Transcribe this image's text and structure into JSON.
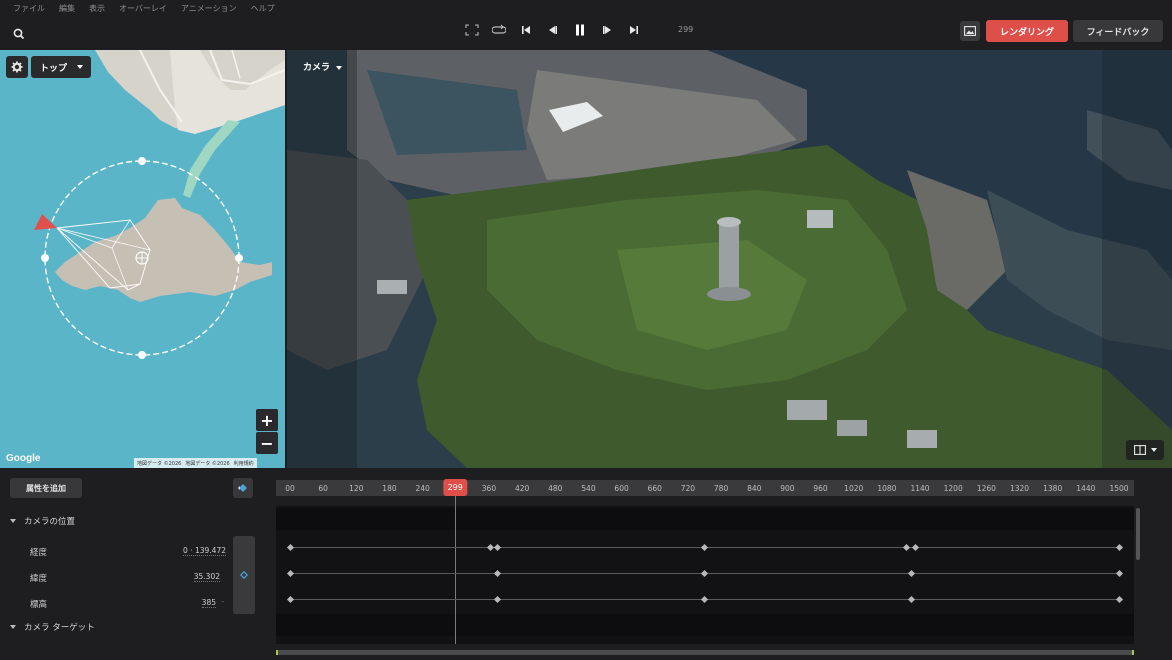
{
  "menu": [
    "ファイル",
    "編集",
    "表示",
    "オーバーレイ",
    "アニメーション",
    "ヘルプ"
  ],
  "toolbar": {
    "search_icon": "search-icon",
    "frame": "299",
    "render_label": "レンダリング",
    "feedback_label": "フィードバック",
    "render_color": "#de4f4a"
  },
  "map": {
    "view_label": "トップ",
    "google": "Google",
    "attribution": [
      "地図データ ©2026",
      "地図データ ©2026",
      "利用規約"
    ],
    "zoom_in": "+",
    "zoom_out": "−"
  },
  "viewport": {
    "camera_label": "カメラ"
  },
  "timeline": {
    "add_attribute": "属性を追加",
    "ticks": [
      "00",
      "60",
      "120",
      "180",
      "240",
      "300",
      "360",
      "420",
      "480",
      "540",
      "600",
      "660",
      "720",
      "780",
      "840",
      "900",
      "960",
      "1020",
      "1080",
      "1140",
      "1200",
      "1260",
      "1320",
      "1380",
      "1440",
      "1500"
    ],
    "playhead": "299",
    "groups": [
      {
        "label": "カメラの位置"
      },
      {
        "label": "カメラ ターゲット"
      }
    ],
    "properties": [
      {
        "name": "経度",
        "prefix": "0 ·",
        "value": "139.472",
        "dash": ""
      },
      {
        "name": "緯度",
        "prefix": "",
        "value": "35.302",
        "dash": ""
      },
      {
        "name": "標高",
        "prefix": "",
        "value": "385",
        "dash": "-"
      }
    ]
  }
}
